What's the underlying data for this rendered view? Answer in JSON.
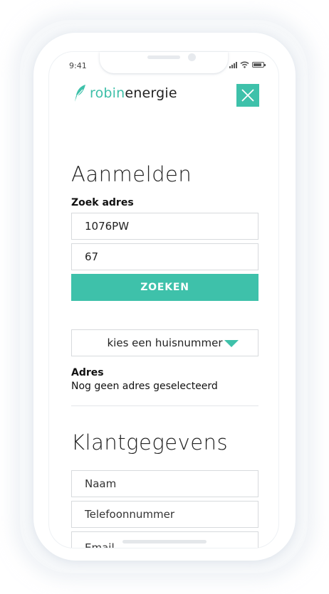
{
  "status_bar": {
    "time": "9:41",
    "icons": [
      "signal-icon",
      "wifi-icon",
      "battery-icon"
    ]
  },
  "header": {
    "logo_text_brand": "robin",
    "logo_text_rest": "energie",
    "logo_icon": "feather-icon",
    "close_icon": "close-icon",
    "accent_color": "#3ec1aa"
  },
  "signup": {
    "title": "Aanmelden",
    "search_label": "Zoek adres",
    "postcode_value": "1076PW",
    "house_number_value": "67",
    "search_button": "ZOEKEN",
    "select_placeholder": "kies een huisnummer",
    "address_label": "Adres",
    "address_value": "Nog geen adres geselecteerd"
  },
  "customer": {
    "title": "Klantgegevens",
    "name_placeholder": "Naam",
    "phone_placeholder": "Telefoonnummer",
    "email_placeholder": "Email"
  }
}
